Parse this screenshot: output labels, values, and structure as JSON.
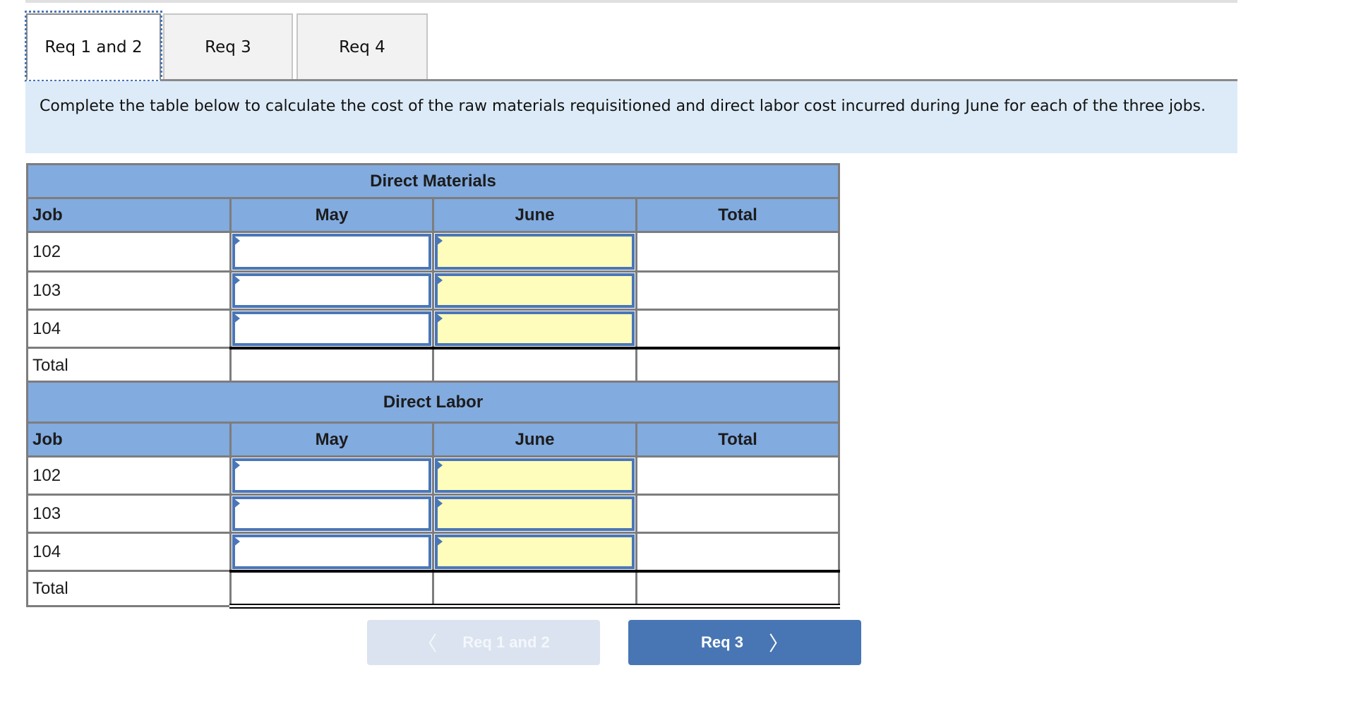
{
  "tabs": [
    {
      "label": "Req 1 and 2",
      "active": true
    },
    {
      "label": "Req 3",
      "active": false
    },
    {
      "label": "Req 4",
      "active": false
    }
  ],
  "instructions": "Complete the table below to calculate the cost of the raw materials requisitioned and direct labor cost incurred during June for each of the three jobs.",
  "direct_materials": {
    "title": "Direct Materials",
    "headers": [
      "Job",
      "May",
      "June",
      "Total"
    ],
    "rows": [
      {
        "job": "102",
        "may": "",
        "june": "",
        "total": ""
      },
      {
        "job": "103",
        "may": "",
        "june": "",
        "total": ""
      },
      {
        "job": "104",
        "may": "",
        "june": "",
        "total": ""
      }
    ],
    "total_row": {
      "label": "Total",
      "may": "",
      "june": "",
      "total": ""
    }
  },
  "direct_labor": {
    "title": "Direct Labor",
    "headers": [
      "Job",
      "May",
      "June",
      "Total"
    ],
    "rows": [
      {
        "job": "102",
        "may": "",
        "june": "",
        "total": ""
      },
      {
        "job": "103",
        "may": "",
        "june": "",
        "total": ""
      },
      {
        "job": "104",
        "may": "",
        "june": "",
        "total": ""
      }
    ],
    "total_row": {
      "label": "Total",
      "may": "",
      "june": "",
      "total": ""
    }
  },
  "nav": {
    "prev_label": "Req 1 and 2",
    "prev_icon": "chevron-left-icon",
    "prev_chevron": "〈",
    "next_label": "Req 3",
    "next_icon": "chevron-right-icon",
    "next_chevron": "〉"
  },
  "colors": {
    "header_blue": "#82abdf",
    "input_border": "#4a76b8",
    "input_yellow": "#fffdbb",
    "instruction_bg": "#ddebf8",
    "next_button": "#4876b4",
    "prev_button_disabled": "#dae3ef"
  }
}
